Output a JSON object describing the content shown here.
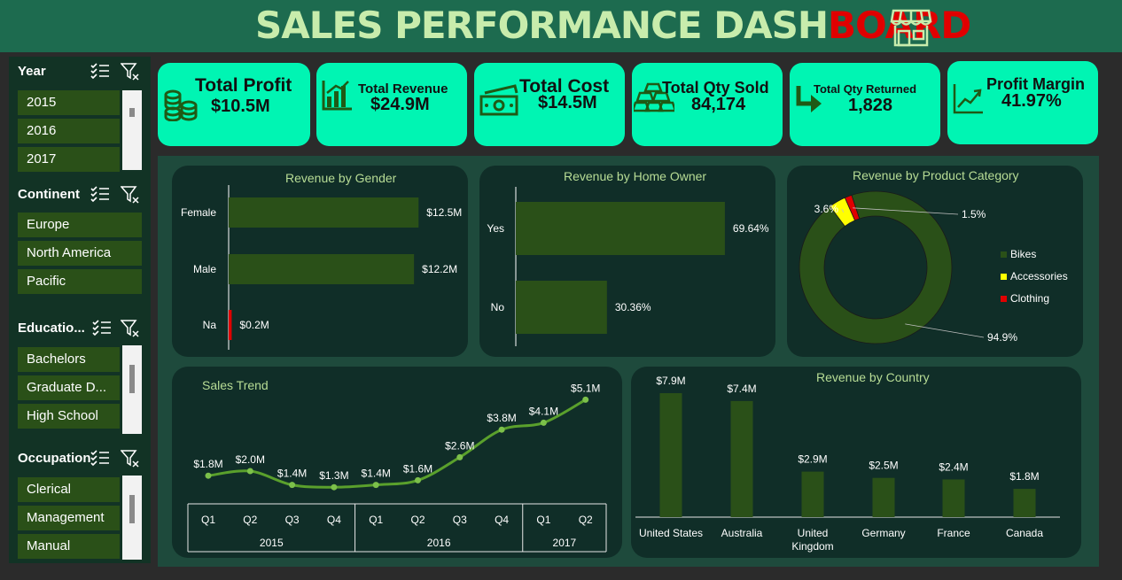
{
  "header": {
    "title_part1": "SALES PERFORMANCE DASH",
    "title_part2": "BOARD",
    "icon": "shop-icon"
  },
  "slicers": [
    {
      "title": "Year",
      "items": [
        "2015",
        "2016",
        "2017"
      ]
    },
    {
      "title": "Continent",
      "items": [
        "Europe",
        "North America",
        "Pacific"
      ]
    },
    {
      "title": "Educatio...",
      "items": [
        "Bachelors",
        "Graduate D...",
        "High School"
      ]
    },
    {
      "title": "Occupation",
      "items": [
        "Clerical",
        "Management",
        "Manual"
      ]
    }
  ],
  "kpis": [
    {
      "label": "Total Profit",
      "value": "$10.5M",
      "icon": "coins-icon"
    },
    {
      "label": "Total Revenue",
      "value": "$24.9M",
      "icon": "bar-chart-icon"
    },
    {
      "label": "Total Cost",
      "value": "$14.5M",
      "icon": "cash-icon"
    },
    {
      "label": "Total Qty Sold",
      "value": "84,174",
      "icon": "gold-bars-icon"
    },
    {
      "label": "Total Qty Returned",
      "value": "1,828",
      "icon": "return-arrow-icon"
    },
    {
      "label": "Profit Margin",
      "value": "41.97%",
      "icon": "trend-up-icon"
    }
  ],
  "colors": {
    "header_bg": "#1d6b4f",
    "kpi_bg": "#00f5b3",
    "bar": "#2a5018",
    "bikes": "#2a5018",
    "accessories": "#ffff00",
    "clothing": "#e00000",
    "line": "#5aa02c",
    "panel_title": "#b7dc95"
  },
  "chart_data": [
    {
      "type": "bar",
      "orientation": "horizontal",
      "title": "Revenue by Gender",
      "categories": [
        "Female",
        "Male",
        "Na"
      ],
      "values": [
        12.5,
        12.2,
        0.2
      ],
      "labels": [
        "$12.5M",
        "$12.2M",
        "$0.2M"
      ],
      "xlim": [
        0,
        14
      ]
    },
    {
      "type": "bar",
      "orientation": "horizontal",
      "title": "Revenue by Home Owner",
      "categories": [
        "Yes",
        "No"
      ],
      "values": [
        69.64,
        30.36
      ],
      "labels": [
        "69.64%",
        "30.36%"
      ],
      "xlim": [
        0,
        80
      ]
    },
    {
      "type": "pie",
      "donut": true,
      "title": "Revenue by Product Category",
      "categories": [
        "Bikes",
        "Accessories",
        "Clothing"
      ],
      "values": [
        94.9,
        3.6,
        1.5
      ],
      "labels": [
        "94.9%",
        "3.6%",
        "1.5%"
      ],
      "legend_position": "right"
    },
    {
      "type": "line",
      "title": "Sales Trend",
      "x": [
        "Q1",
        "Q2",
        "Q3",
        "Q4",
        "Q1",
        "Q2",
        "Q3",
        "Q4",
        "Q1",
        "Q2"
      ],
      "groups": [
        {
          "label": "2015",
          "count": 4
        },
        {
          "label": "2016",
          "count": 4
        },
        {
          "label": "2017",
          "count": 2
        }
      ],
      "values": [
        1.8,
        2.0,
        1.4,
        1.3,
        1.4,
        1.6,
        2.6,
        3.8,
        4.1,
        5.1
      ],
      "labels": [
        "$1.8M",
        "$2.0M",
        "$1.4M",
        "$1.3M",
        "$1.4M",
        "$1.6M",
        "$2.6M",
        "$3.8M",
        "$4.1M",
        "$5.1M"
      ],
      "ylim": [
        0,
        5.5
      ]
    },
    {
      "type": "bar",
      "orientation": "vertical",
      "title": "Revenue by Country",
      "categories": [
        "United States",
        "Australia",
        "United Kingdom",
        "Germany",
        "France",
        "Canada"
      ],
      "values": [
        7.9,
        7.4,
        2.9,
        2.5,
        2.4,
        1.8
      ],
      "labels": [
        "$7.9M",
        "$7.4M",
        "$2.9M",
        "$2.5M",
        "$2.4M",
        "$1.8M"
      ],
      "ylim": [
        0,
        8.5
      ]
    }
  ]
}
